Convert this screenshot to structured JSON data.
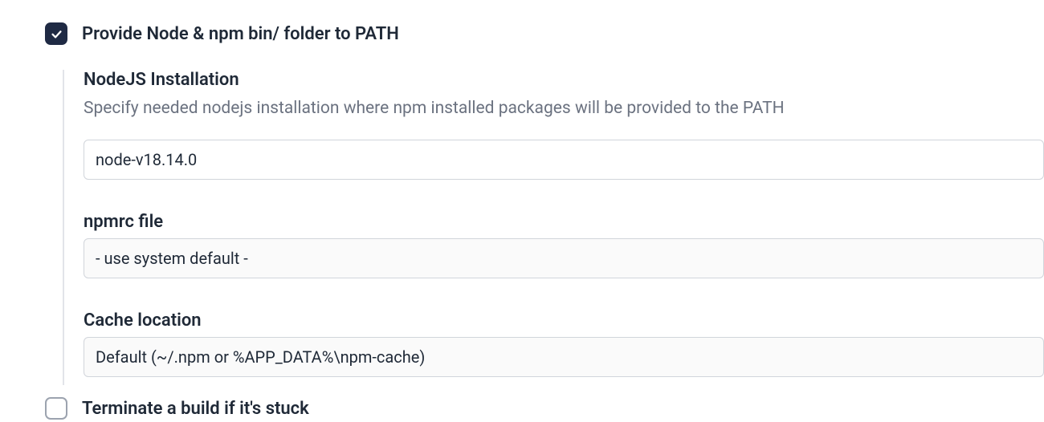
{
  "provide": {
    "label": "Provide Node & npm bin/ folder to PATH",
    "nodejs": {
      "title": "NodeJS Installation",
      "desc": "Specify needed nodejs installation where npm installed packages will be provided to the PATH",
      "value": "node-v18.14.0"
    },
    "npmrc": {
      "title": "npmrc file",
      "value": "- use system default -"
    },
    "cache": {
      "title": "Cache location",
      "value": "Default (~/.npm or %APP_DATA%\\npm-cache)"
    }
  },
  "terminate": {
    "label": "Terminate a build if it's stuck"
  }
}
